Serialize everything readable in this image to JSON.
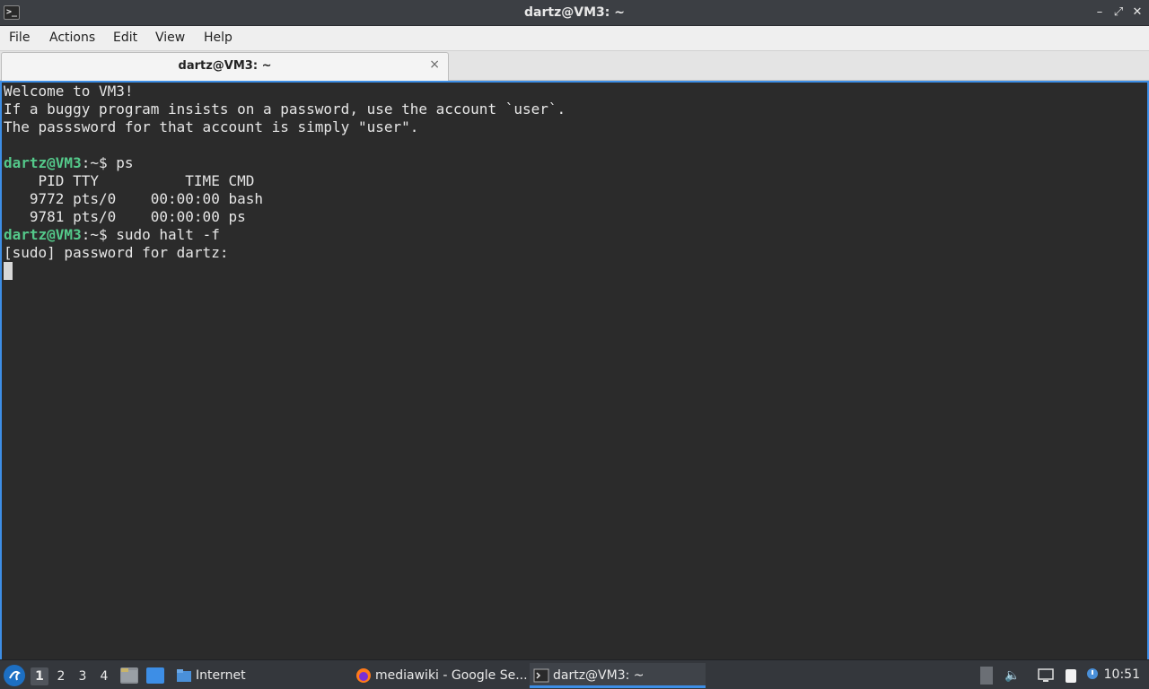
{
  "window": {
    "title": "dartz@VM3: ~",
    "app_icon_text": ">_",
    "minimize": "–",
    "maximize": "⤢",
    "close": "✕"
  },
  "menu": {
    "items": [
      "File",
      "Actions",
      "Edit",
      "View",
      "Help"
    ]
  },
  "tabs": [
    {
      "label": "dartz@VM3: ~",
      "close": "×"
    }
  ],
  "terminal": {
    "lines": [
      {
        "text": "Welcome to VM3!"
      },
      {
        "text": "If a buggy program insists on a password, use the account `user`."
      },
      {
        "text": "The passsword for that account is simply \"user\"."
      },
      {
        "text": ""
      },
      {
        "prompt": "dartz@VM3",
        "suffix": ":~$ ps"
      },
      {
        "text": "    PID TTY          TIME CMD"
      },
      {
        "text": "   9772 pts/0    00:00:00 bash"
      },
      {
        "text": "   9781 pts/0    00:00:00 ps"
      },
      {
        "prompt": "dartz@VM3",
        "suffix": ":~$ sudo halt -f"
      },
      {
        "text": "[sudo] password for dartz:"
      }
    ]
  },
  "taskbar": {
    "start_icon": "start-menu-icon",
    "workspaces": [
      "1",
      "2",
      "3",
      "4"
    ],
    "active_workspace": "1",
    "tasks": [
      {
        "label": "Internet",
        "icon": "folder-icon"
      },
      {
        "label": "mediawiki - Google Se...",
        "icon": "firefox-icon"
      },
      {
        "label": "dartz@VM3: ~",
        "icon": "terminal-icon"
      }
    ],
    "clock": "10:51"
  },
  "colors": {
    "accent": "#3d8ee6",
    "prompt": "#54c98a",
    "terminal_bg": "#2b2b2b"
  }
}
